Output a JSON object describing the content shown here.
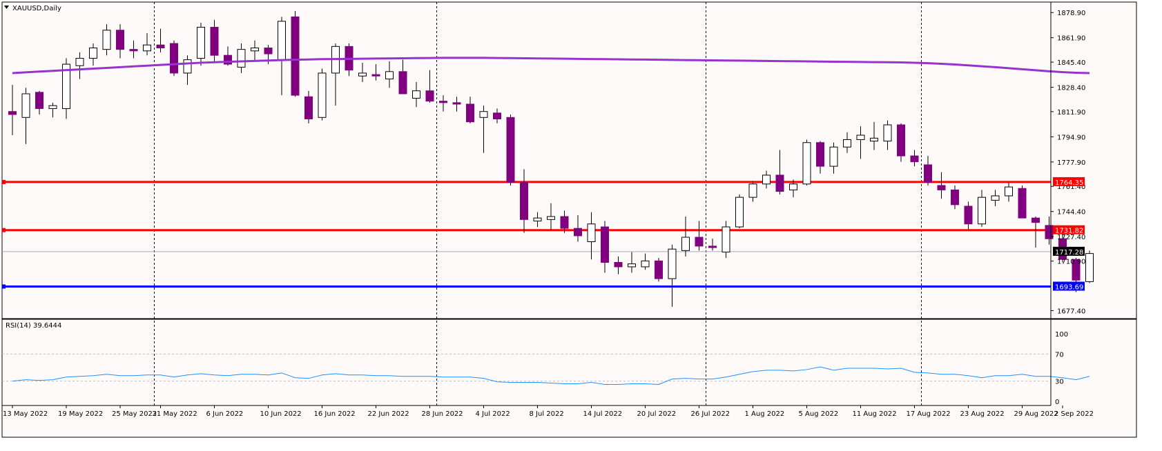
{
  "chart_data": {
    "type": "candlestick",
    "symbol_title": "XAUUSD,Daily",
    "colors": {
      "background": "#fffafa",
      "bear_body": "#800080",
      "bull_body": "#ffffff",
      "wick": "#000000",
      "ma_line": "#9932cc",
      "resistance": "#ff0000",
      "support": "#0000ff",
      "rsi_line": "#1e90ff",
      "grid_vertical": "#000000",
      "current_price_line": "#a0a8b8"
    },
    "price_axis": {
      "min": 1672,
      "max": 1886,
      "ticks": [
        "1878.90",
        "1861.90",
        "1845.40",
        "1828.40",
        "1811.90",
        "1794.90",
        "1777.90",
        "1761.40",
        "1744.40",
        "1727.40",
        "1710.90",
        "1693.69",
        "1677.40"
      ]
    },
    "levels": {
      "resistance_1": {
        "label": "1764.35",
        "value": 1764.35
      },
      "resistance_2": {
        "label": "1731.82",
        "value": 1731.82
      },
      "support_1": {
        "label": "1693.69",
        "value": 1693.69
      },
      "current": {
        "label": "1717.28",
        "value": 1717.28
      }
    },
    "vertical_separators_at_bar": [
      10,
      31,
      51,
      67
    ],
    "date_labels": [
      {
        "label": "13 May 2022",
        "bar": 0
      },
      {
        "label": "19 May 2022",
        "bar": 4
      },
      {
        "label": "25 May 2022",
        "bar": 8
      },
      {
        "label": "31 May 2022",
        "bar": 11
      },
      {
        "label": "6 Jun 2022",
        "bar": 15
      },
      {
        "label": "10 Jun 2022",
        "bar": 19
      },
      {
        "label": "16 Jun 2022",
        "bar": 23
      },
      {
        "label": "22 Jun 2022",
        "bar": 27
      },
      {
        "label": "28 Jun 2022",
        "bar": 31
      },
      {
        "label": "4 Jul 2022",
        "bar": 35
      },
      {
        "label": "8 Jul 2022",
        "bar": 39
      },
      {
        "label": "14 Jul 2022",
        "bar": 43
      },
      {
        "label": "20 Jul 2022",
        "bar": 47
      },
      {
        "label": "26 Jul 2022",
        "bar": 51
      },
      {
        "label": "1 Aug 2022",
        "bar": 55
      },
      {
        "label": "5 Aug 2022",
        "bar": 59
      },
      {
        "label": "11 Aug 2022",
        "bar": 63
      },
      {
        "label": "17 Aug 2022",
        "bar": 67
      },
      {
        "label": "23 Aug 2022",
        "bar": 71
      },
      {
        "label": "29 Aug 2022",
        "bar": 75
      },
      {
        "label": "2 Sep 2022",
        "bar": 78
      }
    ],
    "candles": [
      {
        "o": 1812,
        "h": 1830,
        "l": 1796,
        "c": 1810
      },
      {
        "o": 1808,
        "h": 1828,
        "l": 1790,
        "c": 1824
      },
      {
        "o": 1825,
        "h": 1826,
        "l": 1810,
        "c": 1814
      },
      {
        "o": 1814,
        "h": 1818,
        "l": 1808,
        "c": 1816
      },
      {
        "o": 1814,
        "h": 1848,
        "l": 1807,
        "c": 1844
      },
      {
        "o": 1843,
        "h": 1852,
        "l": 1834,
        "c": 1848
      },
      {
        "o": 1848,
        "h": 1858,
        "l": 1843,
        "c": 1855
      },
      {
        "o": 1854,
        "h": 1871,
        "l": 1850,
        "c": 1867
      },
      {
        "o": 1867,
        "h": 1871,
        "l": 1848,
        "c": 1854
      },
      {
        "o": 1854,
        "h": 1860,
        "l": 1848,
        "c": 1853
      },
      {
        "o": 1853,
        "h": 1865,
        "l": 1850,
        "c": 1857
      },
      {
        "o": 1857,
        "h": 1868,
        "l": 1852,
        "c": 1855
      },
      {
        "o": 1858,
        "h": 1860,
        "l": 1836,
        "c": 1838
      },
      {
        "o": 1838,
        "h": 1850,
        "l": 1830,
        "c": 1847
      },
      {
        "o": 1848,
        "h": 1872,
        "l": 1843,
        "c": 1869
      },
      {
        "o": 1869,
        "h": 1874,
        "l": 1846,
        "c": 1850
      },
      {
        "o": 1850,
        "h": 1856,
        "l": 1843,
        "c": 1844
      },
      {
        "o": 1842,
        "h": 1858,
        "l": 1838,
        "c": 1854
      },
      {
        "o": 1853,
        "h": 1860,
        "l": 1846,
        "c": 1855
      },
      {
        "o": 1855,
        "h": 1857,
        "l": 1844,
        "c": 1851
      },
      {
        "o": 1847,
        "h": 1876,
        "l": 1823,
        "c": 1873
      },
      {
        "o": 1876,
        "h": 1880,
        "l": 1822,
        "c": 1823
      },
      {
        "o": 1822,
        "h": 1826,
        "l": 1804,
        "c": 1807
      },
      {
        "o": 1808,
        "h": 1841,
        "l": 1806,
        "c": 1838
      },
      {
        "o": 1838,
        "h": 1858,
        "l": 1816,
        "c": 1856
      },
      {
        "o": 1856,
        "h": 1858,
        "l": 1836,
        "c": 1840
      },
      {
        "o": 1836,
        "h": 1845,
        "l": 1832,
        "c": 1838
      },
      {
        "o": 1837,
        "h": 1844,
        "l": 1833,
        "c": 1836
      },
      {
        "o": 1834,
        "h": 1846,
        "l": 1828,
        "c": 1839
      },
      {
        "o": 1839,
        "h": 1847,
        "l": 1826,
        "c": 1824
      },
      {
        "o": 1821,
        "h": 1832,
        "l": 1815,
        "c": 1826
      },
      {
        "o": 1826,
        "h": 1840,
        "l": 1818,
        "c": 1819
      },
      {
        "o": 1819,
        "h": 1823,
        "l": 1812,
        "c": 1818
      },
      {
        "o": 1818,
        "h": 1822,
        "l": 1812,
        "c": 1817
      },
      {
        "o": 1817,
        "h": 1822,
        "l": 1804,
        "c": 1805
      },
      {
        "o": 1808,
        "h": 1816,
        "l": 1784,
        "c": 1812
      },
      {
        "o": 1811,
        "h": 1814,
        "l": 1804,
        "c": 1807
      },
      {
        "o": 1808,
        "h": 1810,
        "l": 1762,
        "c": 1764
      },
      {
        "o": 1764,
        "h": 1773,
        "l": 1730,
        "c": 1739
      },
      {
        "o": 1738,
        "h": 1744,
        "l": 1734,
        "c": 1740
      },
      {
        "o": 1739,
        "h": 1750,
        "l": 1732,
        "c": 1741
      },
      {
        "o": 1741,
        "h": 1745,
        "l": 1730,
        "c": 1733
      },
      {
        "o": 1733,
        "h": 1742,
        "l": 1724,
        "c": 1728
      },
      {
        "o": 1724,
        "h": 1744,
        "l": 1712,
        "c": 1736
      },
      {
        "o": 1734,
        "h": 1738,
        "l": 1703,
        "c": 1710
      },
      {
        "o": 1710,
        "h": 1714,
        "l": 1702,
        "c": 1707
      },
      {
        "o": 1707,
        "h": 1717,
        "l": 1703,
        "c": 1709
      },
      {
        "o": 1707,
        "h": 1716,
        "l": 1705,
        "c": 1711
      },
      {
        "o": 1711,
        "h": 1713,
        "l": 1697,
        "c": 1699
      },
      {
        "o": 1699,
        "h": 1722,
        "l": 1680,
        "c": 1719
      },
      {
        "o": 1718,
        "h": 1741,
        "l": 1714,
        "c": 1727
      },
      {
        "o": 1727,
        "h": 1738,
        "l": 1718,
        "c": 1721
      },
      {
        "o": 1721,
        "h": 1726,
        "l": 1718,
        "c": 1720
      },
      {
        "o": 1717,
        "h": 1738,
        "l": 1713,
        "c": 1734
      },
      {
        "o": 1734,
        "h": 1756,
        "l": 1733,
        "c": 1754
      },
      {
        "o": 1754,
        "h": 1765,
        "l": 1751,
        "c": 1763
      },
      {
        "o": 1763,
        "h": 1772,
        "l": 1760,
        "c": 1769
      },
      {
        "o": 1769,
        "h": 1786,
        "l": 1756,
        "c": 1758
      },
      {
        "o": 1759,
        "h": 1766,
        "l": 1754,
        "c": 1763
      },
      {
        "o": 1763,
        "h": 1793,
        "l": 1762,
        "c": 1791
      },
      {
        "o": 1791,
        "h": 1792,
        "l": 1770,
        "c": 1775
      },
      {
        "o": 1775,
        "h": 1791,
        "l": 1770,
        "c": 1788
      },
      {
        "o": 1788,
        "h": 1798,
        "l": 1784,
        "c": 1793
      },
      {
        "o": 1793,
        "h": 1802,
        "l": 1780,
        "c": 1796
      },
      {
        "o": 1792,
        "h": 1805,
        "l": 1786,
        "c": 1794
      },
      {
        "o": 1792,
        "h": 1806,
        "l": 1786,
        "c": 1803
      },
      {
        "o": 1803,
        "h": 1804,
        "l": 1778,
        "c": 1782
      },
      {
        "o": 1782,
        "h": 1786,
        "l": 1775,
        "c": 1778
      },
      {
        "o": 1776,
        "h": 1782,
        "l": 1762,
        "c": 1764
      },
      {
        "o": 1762,
        "h": 1771,
        "l": 1753,
        "c": 1759
      },
      {
        "o": 1759,
        "h": 1762,
        "l": 1746,
        "c": 1749
      },
      {
        "o": 1748,
        "h": 1751,
        "l": 1732,
        "c": 1736
      },
      {
        "o": 1736,
        "h": 1759,
        "l": 1734,
        "c": 1754
      },
      {
        "o": 1752,
        "h": 1759,
        "l": 1748,
        "c": 1755
      },
      {
        "o": 1755,
        "h": 1764,
        "l": 1751,
        "c": 1761
      },
      {
        "o": 1760,
        "h": 1762,
        "l": 1740,
        "c": 1740
      },
      {
        "o": 1740,
        "h": 1741,
        "l": 1720,
        "c": 1737
      },
      {
        "o": 1735,
        "h": 1741,
        "l": 1722,
        "c": 1726
      },
      {
        "o": 1726,
        "h": 1731,
        "l": 1710,
        "c": 1712
      },
      {
        "o": 1712,
        "h": 1713,
        "l": 1690,
        "c": 1698
      },
      {
        "o": 1697,
        "h": 1718,
        "l": 1696,
        "c": 1716
      }
    ],
    "ma": [
      1838,
      1838.5,
      1839,
      1839.5,
      1840,
      1840.5,
      1841,
      1841.5,
      1842,
      1842.5,
      1843,
      1843.5,
      1844,
      1844.5,
      1845,
      1845.3,
      1845.6,
      1845.9,
      1846.2,
      1846.5,
      1846.8,
      1847,
      1847.2,
      1847.4,
      1847.5,
      1847.6,
      1847.7,
      1847.8,
      1847.9,
      1848,
      1848.1,
      1848.2,
      1848.3,
      1848.3,
      1848.3,
      1848.3,
      1848.2,
      1848.1,
      1848,
      1847.9,
      1847.8,
      1847.7,
      1847.6,
      1847.5,
      1847.4,
      1847.3,
      1847.2,
      1847.1,
      1847,
      1846.9,
      1846.8,
      1846.7,
      1846.6,
      1846.5,
      1846.4,
      1846.3,
      1846.2,
      1846.1,
      1846,
      1845.9,
      1845.8,
      1845.7,
      1845.6,
      1845.5,
      1845.4,
      1845.3,
      1845.2,
      1845,
      1844.7,
      1844.3,
      1843.8,
      1843.2,
      1842.6,
      1842,
      1841.3,
      1840.6,
      1839.9,
      1839.2,
      1838.6,
      1838.2,
      1838
    ],
    "rsi": {
      "label": "RSI(14) 39.6444",
      "axis_ticks": [
        "100",
        "70",
        "30",
        "0"
      ],
      "levels": [
        70,
        30
      ],
      "values": [
        30,
        32,
        31,
        32,
        36,
        37,
        38,
        40,
        38,
        38,
        39,
        39,
        36,
        39,
        41,
        39,
        38,
        40,
        40,
        39,
        42,
        35,
        34,
        39,
        41,
        39,
        39,
        38,
        38,
        37,
        37,
        37,
        36,
        36,
        36,
        34,
        29,
        28,
        28,
        28,
        27,
        26,
        26,
        28,
        25,
        25,
        26,
        26,
        25,
        33,
        34,
        33,
        33,
        36,
        40,
        44,
        46,
        46,
        45,
        47,
        51,
        46,
        49,
        49,
        49,
        48,
        49,
        43,
        42,
        40,
        40,
        38,
        35,
        38,
        38,
        40,
        37,
        37,
        35,
        32,
        37
      ]
    }
  }
}
